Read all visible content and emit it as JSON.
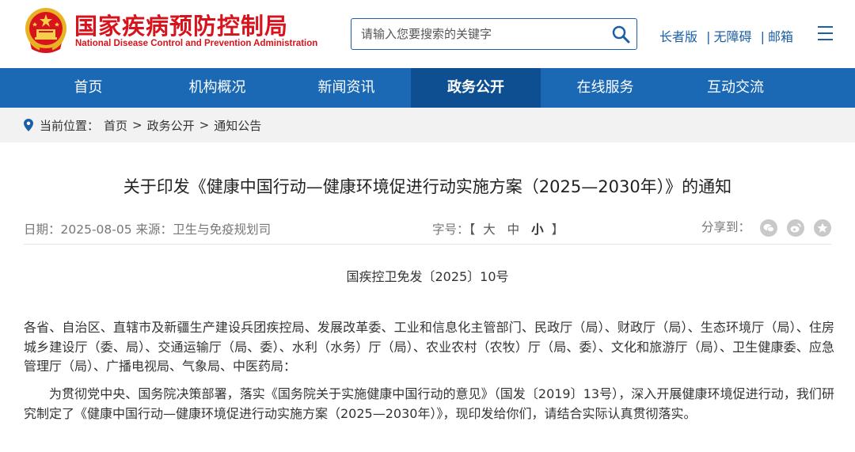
{
  "header": {
    "logo_cn": "国家疾病预防控制局",
    "logo_en": "National Disease Control and Prevention Administration",
    "search_placeholder": "请输入您要搜索的关键字",
    "links": [
      "长者版",
      "无障碍",
      "邮箱"
    ],
    "separator": "|"
  },
  "nav": {
    "items": [
      "首页",
      "机构概况",
      "新闻资讯",
      "政务公开",
      "在线服务",
      "互动交流"
    ],
    "active_index": 3
  },
  "breadcrumb": {
    "label": "当前位置：",
    "items": [
      "首页",
      "政务公开",
      "通知公告"
    ],
    "separator": ">"
  },
  "article": {
    "title": "关于印发《健康中国行动—健康环境促进行动实施方案（2025—2030年）》的通知",
    "date_label": "日期：",
    "date": "2025-08-05",
    "source_label": "来源：",
    "source": "卫生与免疫规划司",
    "font_size_label": "字号：",
    "font_size_open": "【",
    "font_sizes": [
      "大",
      "中",
      "小"
    ],
    "font_size_close": "】",
    "share_label": "分享到：",
    "share_icons": [
      "wechat-icon",
      "weibo-icon",
      "favorite-icon"
    ],
    "doc_number": "国疾控卫免发〔2025〕10号",
    "paragraph_1": "各省、自治区、直辖市及新疆生产建设兵团疾控局、发展改革委、工业和信息化主管部门、民政厅（局）、财政厅（局）、生态环境厅（局）、住房城乡建设厅（委、局）、交通运输厅（局、委）、水利（水务）厅（局）、农业农村（农牧）厅（局、委）、文化和旅游厅（局）、卫生健康委、应急管理厅（局）、广播电视局、气象局、中医药局：",
    "paragraph_2": "为贯彻党中央、国务院决策部署，落实《国务院关于实施健康中国行动的意见》（国发〔2019〕13号），深入开展健康环境促进行动，我们研究制定了《健康中国行动—健康环境促进行动实施方案（2025—2030年）》，现印发给你们，请结合实际认真贯彻落实。"
  },
  "colors": {
    "brand_red": "#d7141d",
    "nav_blue": "#1b69b5",
    "nav_active": "#0e4f91",
    "link_blue": "#1b5fa6"
  }
}
